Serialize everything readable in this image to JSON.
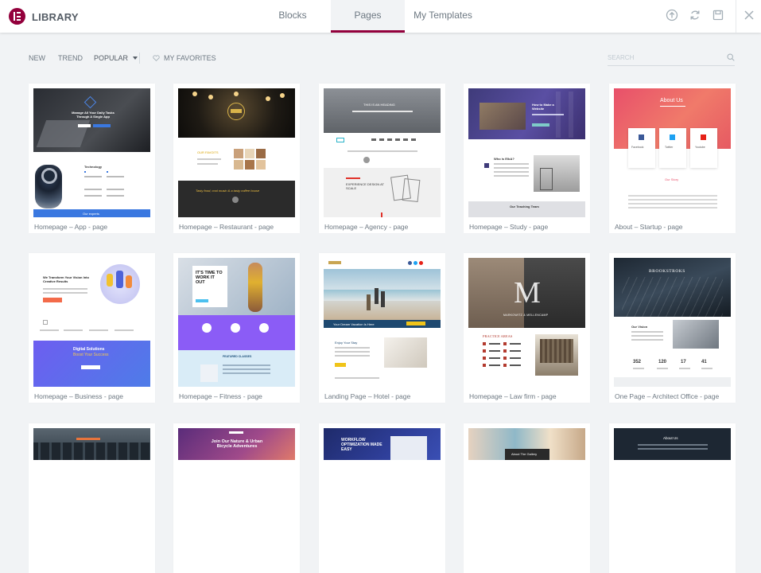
{
  "header": {
    "title": "LIBRARY",
    "tabs": [
      {
        "label": "Blocks",
        "active": false
      },
      {
        "label": "Pages",
        "active": true
      },
      {
        "label": "My Templates",
        "active": false
      }
    ],
    "icons": [
      "upload-icon",
      "sync-icon",
      "save-icon",
      "close-icon"
    ],
    "accent_color": "#93003c"
  },
  "toolbar": {
    "filters": [
      {
        "label": "NEW",
        "active": false
      },
      {
        "label": "TREND",
        "active": false
      },
      {
        "label": "POPULAR",
        "active": true
      }
    ],
    "favorites_label": "MY FAVORITES",
    "search_placeholder": "SEARCH"
  },
  "templates": [
    {
      "label": "Homepage – App - page",
      "thumb": {
        "title": "Manage All Your Daily Tasks Through A Single App",
        "section": "Technology",
        "footer": "Our experts"
      }
    },
    {
      "label": "Homepage – Restaurant - page",
      "thumb": {
        "section": "OUR FAVOITS",
        "quote": "Tasty food, cool music & a tasty coffee house"
      }
    },
    {
      "label": "Homepage – Agency - page",
      "thumb": {
        "title": "THIS IS AN HEADING",
        "section": "EXPERIENCE DESIGN AT SCALE"
      }
    },
    {
      "label": "Homepage – Study - page",
      "thumb": {
        "title": "How to Make a Website",
        "section": "Who is ElbA?",
        "footer": "Our Teaching Team"
      }
    },
    {
      "label": "About – Startup - page",
      "thumb": {
        "title": "About Us",
        "networks": [
          "Facebook",
          "Twitter",
          "Youtube"
        ],
        "section": "Our Story"
      }
    },
    {
      "label": "Homepage – Business - page",
      "thumb": {
        "title": "We Transform Your Vision Into Creative Results",
        "section": "Digital Solutions",
        "subtitle": "Boost Your Success"
      }
    },
    {
      "label": "Homepage – Fitness - page",
      "thumb": {
        "title": "IT'S TIME TO WORK IT OUT",
        "section": "FEATURED CLASSES"
      }
    },
    {
      "label": "Landing Page – Hotel - page",
      "thumb": {
        "title": "Your Dream Vacation Is Here",
        "section": "Enjoy Your Stay"
      }
    },
    {
      "label": "Homepage – Law firm - page",
      "thumb": {
        "title": "MARKOWITZ & MELLENCAMP",
        "section": "PRACTICE AREAS"
      }
    },
    {
      "label": "One Page – Architect Office - page",
      "thumb": {
        "title": "BROOKSTROKS",
        "section": "Our Vision",
        "stats": [
          "352",
          "120",
          "17",
          "41"
        ]
      }
    },
    {
      "label": "",
      "thumb": {
        "title": ""
      }
    },
    {
      "label": "",
      "thumb": {
        "title": "Join Our Nature & Urban Bicycle Adventures"
      }
    },
    {
      "label": "",
      "thumb": {
        "title": "WORKFLOW OPTIMIZATION MADE EASY"
      }
    },
    {
      "label": "",
      "thumb": {
        "title": "About The Gallery"
      }
    },
    {
      "label": "",
      "thumb": {
        "title": "About Us"
      }
    }
  ]
}
